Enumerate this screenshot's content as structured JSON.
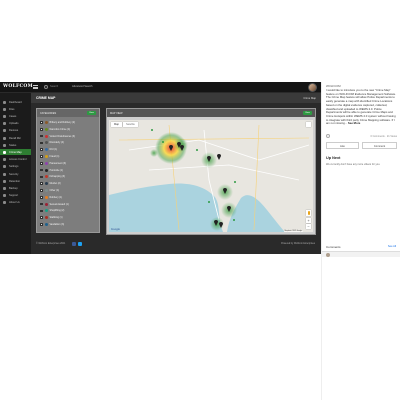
{
  "app": {
    "logo": "WOLFCOM",
    "search_placeholder": "Search",
    "advanced_search": "Advanced Search"
  },
  "sidebar": {
    "items": [
      {
        "label": "Dashboard",
        "active": false
      },
      {
        "label": "Files",
        "active": false
      },
      {
        "label": "Cases",
        "active": false
      },
      {
        "label": "Uploads",
        "active": false
      },
      {
        "label": "Devices",
        "active": false
      },
      {
        "label": "Recall Mic",
        "active": false
      },
      {
        "label": "Status",
        "active": false
      },
      {
        "label": "Crime Map",
        "active": true
      },
      {
        "label": "Access Control",
        "active": false
      },
      {
        "label": "Settings",
        "active": false
      },
      {
        "label": "Security",
        "active": false
      },
      {
        "label": "Retention",
        "active": false
      },
      {
        "label": "Backup",
        "active": false
      },
      {
        "label": "Support",
        "active": false
      },
      {
        "label": "About Us",
        "active": false
      }
    ]
  },
  "page": {
    "title": "CRIME MAP",
    "breadcrumb": "Crime Map"
  },
  "categories": {
    "title": "CATEGORIES",
    "button": "View",
    "items": [
      {
        "label": "Bribery and Robbery (2)",
        "color": "#8b5a2b"
      },
      {
        "label": "Narcotics Crime (4)",
        "color": "#6b8e23"
      },
      {
        "label": "Violent Disturbances (3)",
        "color": "#cc3333"
      },
      {
        "label": "Disorderly (4)",
        "color": "#555555"
      },
      {
        "label": "DUI (1)",
        "color": "#3a6ea5"
      },
      {
        "label": "Fraud (1)",
        "color": "#d4a017"
      },
      {
        "label": "Harassment (3)",
        "color": "#8e44ad"
      },
      {
        "label": "Homicide (1)",
        "color": "#222222"
      },
      {
        "label": "Kidnapping (3)",
        "color": "#c0392b"
      },
      {
        "label": "Murder (2)",
        "color": "#2c3e50"
      },
      {
        "label": "Other (4)",
        "color": "#7f8c8d"
      },
      {
        "label": "Robbery (1)",
        "color": "#e67e22"
      },
      {
        "label": "Sexual Assault (1)",
        "color": "#9b2335"
      },
      {
        "label": "Shoplifting (2)",
        "color": "#16a085"
      },
      {
        "label": "Stabbing (1)",
        "color": "#a93226"
      },
      {
        "label": "Vandalism (3)",
        "color": "#1f618d"
      }
    ]
  },
  "map": {
    "title": "MAP VIEW",
    "button": "View",
    "tabs": [
      "Map",
      "Satellite"
    ],
    "attribution": "Map data ©2021 Google",
    "google": "Google",
    "zoom_in": "+",
    "zoom_out": "−",
    "colors": {
      "water": "#aad3df",
      "land": "#e8e6e0",
      "heat_hot": "#e53935",
      "heat_mid": "#fdd835",
      "heat_cool": "#43a047"
    }
  },
  "footer": {
    "left": "© Wolfcom Enterprises 2021",
    "right": "Powered by Wolfcom Enterprises"
  },
  "panel": {
    "handle": "WOLFCOM",
    "description": "I would like to introduce you to the new \"Crime Map\" feature on WOLFCOM Evidence Management Software. The Crime Map feature will allow Police Departments to easily generate a map with identified Crime Locations based on the digital evidence captured, collected, classified and uploaded to WEMS 2.0. Police Departments will be able to generate Crime Maps and Crime Hotspots within WEMS 2.0 system without having to integrate with third party Crime Mapping software. If I am not missing...",
    "show_more": "See More",
    "comments_count": "0 Comments · 21 Views",
    "like": "Like",
    "comment": "Comment",
    "up_next_title": "Up Next",
    "up_next_text": "We currently don't have any more videos for you.",
    "comments_title": "Comments",
    "see_all": "See All"
  }
}
